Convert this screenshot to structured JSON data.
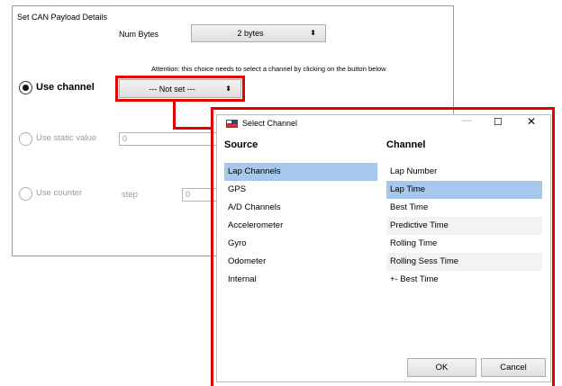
{
  "panel": {
    "title": "Set CAN Payload Details",
    "num_bytes_label": "Num Bytes",
    "num_bytes_value": "2 bytes",
    "attention": "Attention: this choice needs to select a channel by clicking on the button below",
    "channel_select_value": "--- Not set ---",
    "use_channel_label": "Use channel",
    "use_static_label": "Use static value",
    "static_value": "0",
    "use_counter_label": "Use counter",
    "step_label": "step",
    "step_value": "0"
  },
  "dialog": {
    "title": "Select Channel",
    "source_header": "Source",
    "channel_header": "Channel",
    "sources": [
      "Lap Channels",
      "GPS",
      "A/D Channels",
      "Accelerometer",
      "Gyro",
      "Odometer",
      "Internal"
    ],
    "selected_source": "Lap Channels",
    "channels": [
      "Lap Number",
      "Lap Time",
      "Best Time",
      "Predictive Time",
      "Rolling Time",
      "Rolling Sess Time",
      "+- Best Time"
    ],
    "selected_channel": "Lap Time",
    "ok_label": "OK",
    "cancel_label": "Cancel"
  },
  "icons": {
    "dropdown_arrow": "up-down-arrows-icon",
    "app_icon": "app-icon",
    "minimize": "minimize-icon",
    "maximize": "maximize-icon",
    "close": "close-icon"
  },
  "colors": {
    "highlight_red": "#e00000",
    "selection_blue": "#a6c7ee"
  }
}
